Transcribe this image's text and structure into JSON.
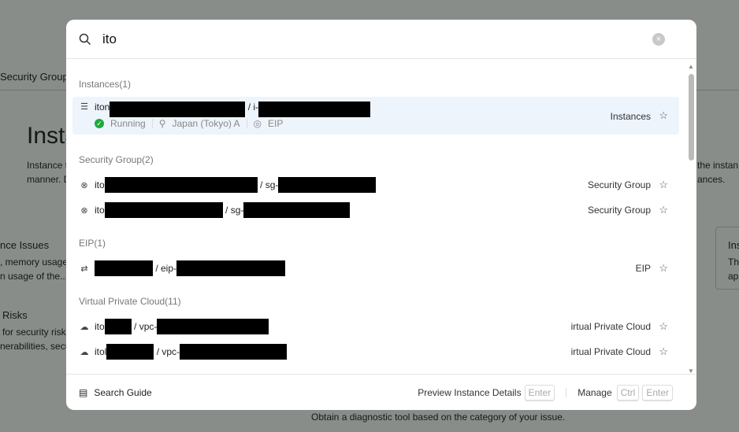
{
  "background": {
    "tab": "Security Group",
    "title": "Insta",
    "desc1": "Instance t",
    "desc2": "manner. D",
    "right1": "the instan",
    "right2": "ances.",
    "card1_title": "nce Issues",
    "card1_l1": ", memory usage",
    "card1_l2": "n usage of the...",
    "card2_title": "Risks",
    "card2_l1": "for security risk",
    "card2_l2": "nerabilities, secu",
    "card3_title": "Ins",
    "card3_l1": "Th",
    "card3_l2": "ap",
    "bottom": "Obtain a diagnostic tool based on the category of your issue."
  },
  "search": {
    "value": "ito",
    "clear": "×"
  },
  "sections": [
    {
      "title": "Instances(1)",
      "items": [
        {
          "prefix": "iton",
          "mid": "/ i-",
          "type": "Instances",
          "status": "Running",
          "zone": "Japan (Tokyo) A",
          "eip": "EIP"
        }
      ]
    },
    {
      "title": "Security Group(2)",
      "items": [
        {
          "prefix": "ito",
          "mid": "/ sg-",
          "type": "Security Group"
        },
        {
          "prefix": "ito",
          "mid": "/ sg-",
          "type": "Security Group"
        }
      ]
    },
    {
      "title": "EIP(1)",
      "items": [
        {
          "prefix": "",
          "mid": "/ eip-",
          "type": "EIP"
        }
      ]
    },
    {
      "title": "Virtual Private Cloud(11)",
      "items": [
        {
          "prefix": "ito",
          "mid": "/ vpc-",
          "type": "irtual Private Cloud"
        },
        {
          "prefix": "itol",
          "mid": "/ vpc-",
          "type": "irtual Private Cloud"
        }
      ]
    }
  ],
  "footer": {
    "guide": "Search Guide",
    "preview": "Preview Instance Details",
    "enter": "Enter",
    "manage": "Manage",
    "ctrl": "Ctrl",
    "enter2": "Enter"
  }
}
